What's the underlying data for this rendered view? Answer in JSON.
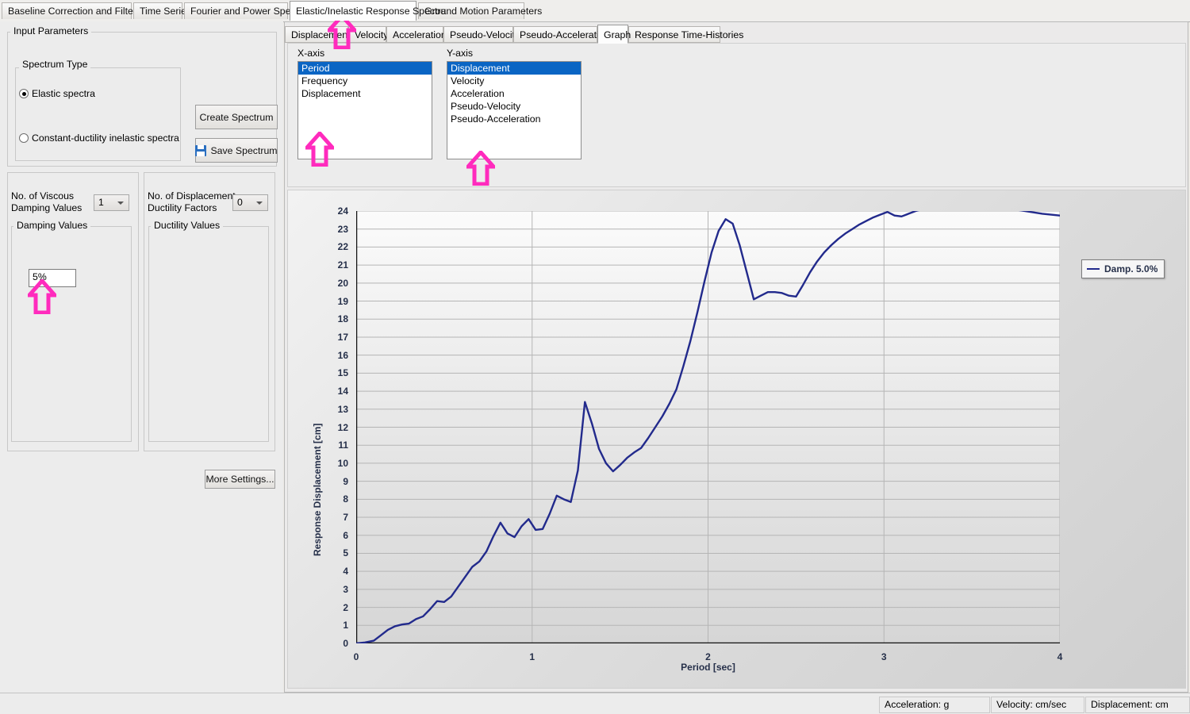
{
  "app": {
    "accent_selection": "#0a65c4",
    "curve_color": "#222a8c",
    "annotation_color": "#ff2bbd"
  },
  "main_tabs": [
    {
      "label": "Baseline Correction and Filtering",
      "selected": false
    },
    {
      "label": "Time Series",
      "selected": false
    },
    {
      "label": "Fourier and Power Spectra",
      "selected": false
    },
    {
      "label": "Elastic/Inelastic Response Spectra",
      "selected": true
    },
    {
      "label": "Ground Motion Parameters",
      "selected": false
    }
  ],
  "sub_tabs": [
    {
      "label": "Displacement",
      "selected": false
    },
    {
      "label": "Velocity",
      "selected": false
    },
    {
      "label": "Acceleration",
      "selected": false
    },
    {
      "label": "Pseudo-Velocity",
      "selected": false
    },
    {
      "label": "Pseudo-Acceleration",
      "selected": false
    },
    {
      "label": "Graph",
      "selected": true
    },
    {
      "label": "Response Time-Histories",
      "selected": false
    }
  ],
  "input_parameters": {
    "title": "Input Parameters",
    "spectrum_type": {
      "title": "Spectrum Type",
      "options": [
        {
          "label": "Elastic spectra",
          "checked": true
        },
        {
          "label": "Constant-ductility inelastic spectra",
          "checked": false
        }
      ]
    },
    "buttons": {
      "create_spectrum": "Create Spectrum",
      "save_spectrum": "Save Spectrum",
      "more_settings": "More Settings..."
    },
    "viscous_damping": {
      "label_line1": "No. of Viscous",
      "label_line2": "Damping Values",
      "count": "1",
      "group_title": "Damping Values",
      "values": [
        "5%"
      ]
    },
    "ductility": {
      "label_line1": "No. of Displacement",
      "label_line2": "Ductility Factors",
      "count": "0",
      "group_title": "Ductility Values",
      "values": []
    }
  },
  "axis_selectors": {
    "x_axis": {
      "title": "X-axis",
      "options": [
        "Period",
        "Frequency",
        "Displacement"
      ],
      "selected": "Period"
    },
    "y_axis": {
      "title": "Y-axis",
      "options": [
        "Displacement",
        "Velocity",
        "Acceleration",
        "Pseudo-Velocity",
        "Pseudo-Acceleration"
      ],
      "selected": "Displacement"
    }
  },
  "status_bar": {
    "acceleration": "Acceleration: g",
    "velocity": "Velocity: cm/sec",
    "displacement": "Displacement: cm"
  },
  "chart_data": {
    "type": "line",
    "title": "",
    "xlabel": "Period [sec]",
    "ylabel": "Response Displacement [cm]",
    "xlim": [
      0,
      4
    ],
    "ylim": [
      0,
      24
    ],
    "xticks": [
      0,
      1,
      2,
      3,
      4
    ],
    "yticks": [
      0,
      1,
      2,
      3,
      4,
      5,
      6,
      7,
      8,
      9,
      10,
      11,
      12,
      13,
      14,
      15,
      16,
      17,
      18,
      19,
      20,
      21,
      22,
      23,
      24
    ],
    "grid": true,
    "legend_position": "right",
    "series": [
      {
        "name": "Damp. 5.0%",
        "color": "#222a8c",
        "x": [
          0.0,
          0.05,
          0.1,
          0.14,
          0.18,
          0.22,
          0.26,
          0.3,
          0.34,
          0.38,
          0.42,
          0.46,
          0.5,
          0.54,
          0.58,
          0.62,
          0.66,
          0.7,
          0.74,
          0.78,
          0.82,
          0.86,
          0.9,
          0.94,
          0.98,
          1.02,
          1.06,
          1.1,
          1.14,
          1.18,
          1.22,
          1.26,
          1.3,
          1.34,
          1.38,
          1.42,
          1.46,
          1.5,
          1.54,
          1.58,
          1.62,
          1.66,
          1.7,
          1.74,
          1.78,
          1.82,
          1.86,
          1.9,
          1.94,
          1.98,
          2.02,
          2.06,
          2.1,
          2.14,
          2.18,
          2.22,
          2.26,
          2.3,
          2.34,
          2.38,
          2.42,
          2.46,
          2.5,
          2.54,
          2.58,
          2.62,
          2.66,
          2.7,
          2.74,
          2.78,
          2.82,
          2.86,
          2.9,
          2.94,
          2.98,
          3.02,
          3.06,
          3.1,
          3.14,
          3.18,
          3.22,
          3.3,
          3.4,
          3.5,
          3.6,
          3.7,
          3.8,
          3.9,
          4.0
        ],
        "y": [
          0.0,
          0.05,
          0.15,
          0.45,
          0.75,
          0.95,
          1.05,
          1.1,
          1.35,
          1.5,
          1.9,
          2.35,
          2.3,
          2.6,
          3.15,
          3.7,
          4.25,
          4.55,
          5.1,
          5.95,
          6.7,
          6.1,
          5.9,
          6.5,
          6.9,
          6.3,
          6.35,
          7.2,
          8.2,
          8.0,
          7.85,
          9.6,
          13.4,
          12.2,
          10.8,
          10.0,
          9.55,
          9.9,
          10.3,
          10.6,
          10.85,
          11.4,
          12.0,
          12.6,
          13.3,
          14.1,
          15.4,
          16.8,
          18.4,
          20.1,
          21.7,
          22.9,
          23.55,
          23.3,
          22.1,
          20.6,
          19.1,
          19.3,
          19.5,
          19.5,
          19.45,
          19.3,
          19.25,
          19.9,
          20.6,
          21.2,
          21.7,
          22.1,
          22.45,
          22.75,
          23.0,
          23.25,
          23.45,
          23.65,
          23.8,
          23.95,
          23.75,
          23.7,
          23.85,
          24.0,
          24.1,
          24.2,
          24.25,
          24.28,
          24.25,
          24.15,
          24.0,
          23.85,
          23.75
        ]
      }
    ]
  }
}
